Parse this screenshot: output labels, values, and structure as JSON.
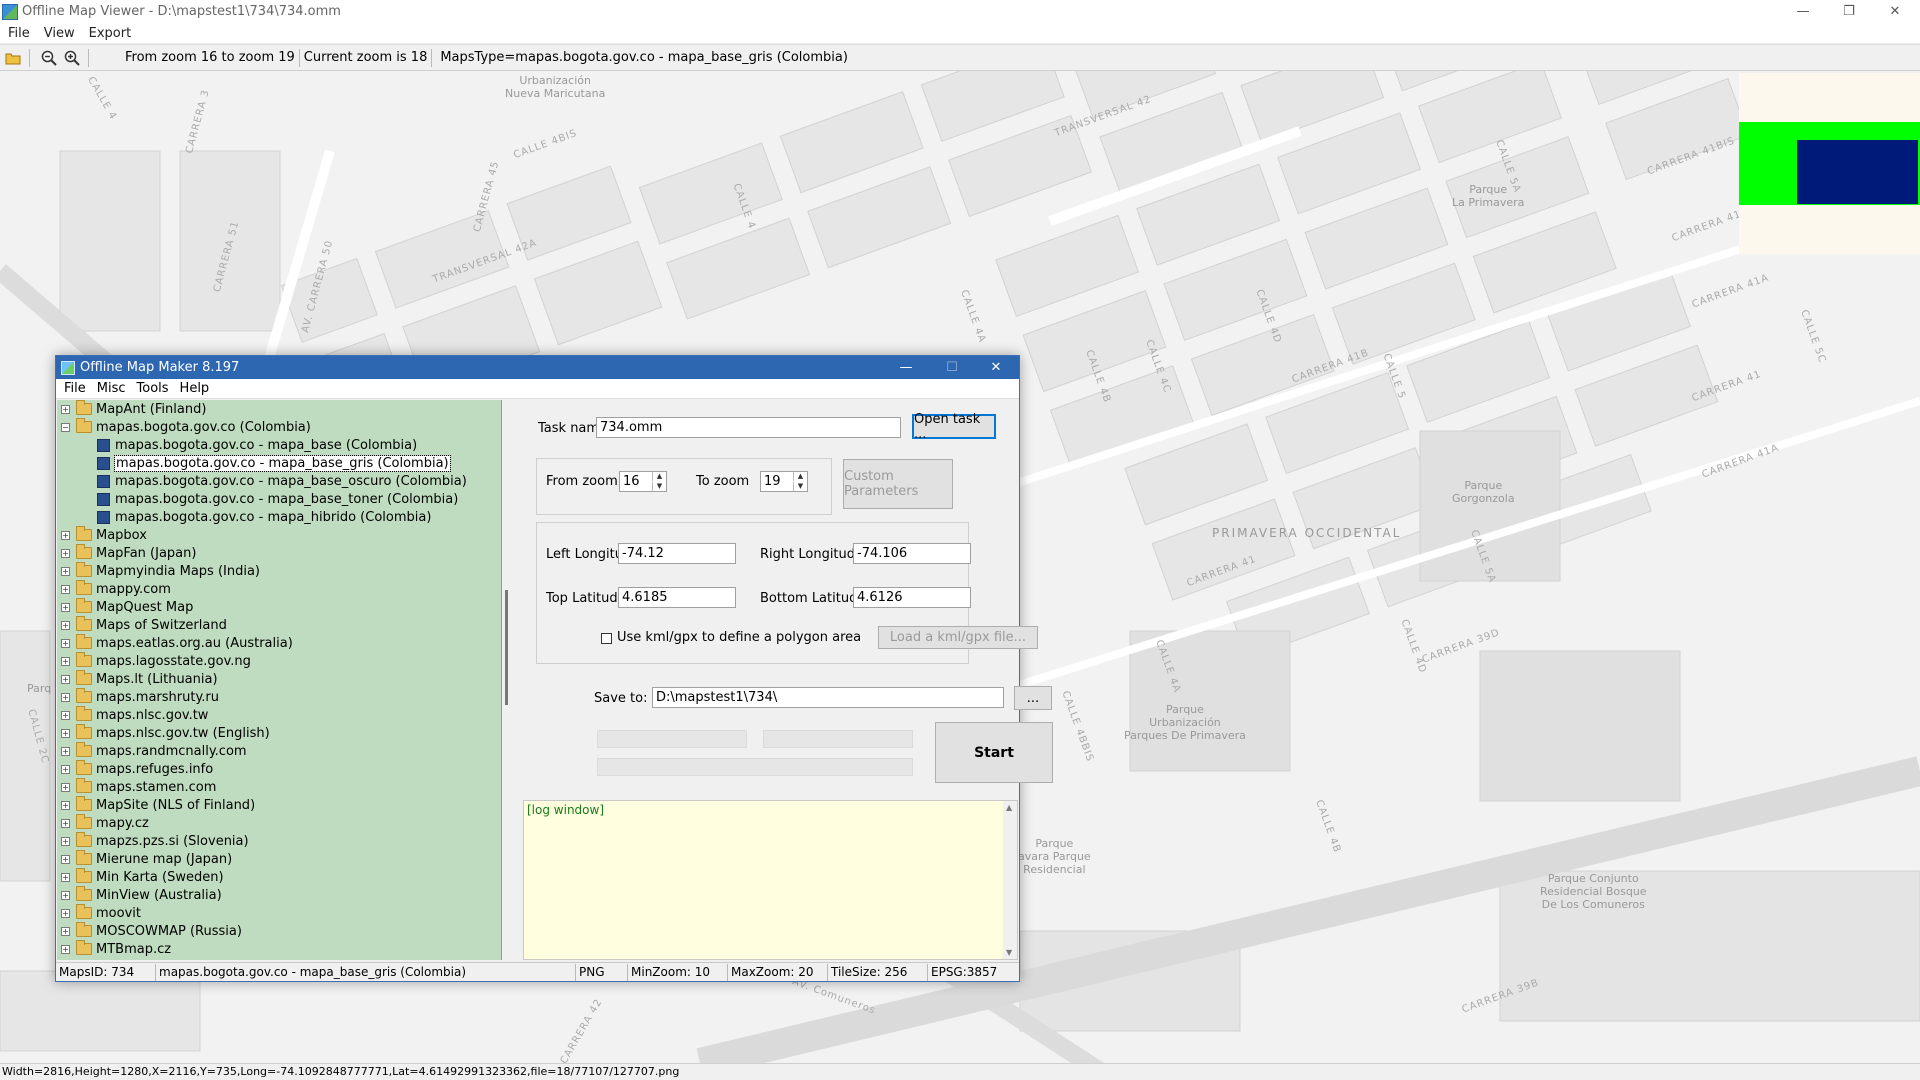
{
  "window": {
    "title": "Offline Map Viewer - D:\\mapstest1\\734\\734.omm",
    "minimize": "—",
    "restore": "❐",
    "close": "✕"
  },
  "menu": {
    "file": "File",
    "view": "View",
    "export": "Export"
  },
  "toolbar": {
    "zoom_range": "From zoom 16 to zoom 19",
    "current_zoom": "Current zoom is 18",
    "maps_type": "MapsType=mapas.bogota.gov.co - mapa_base_gris (Colombia)"
  },
  "map": {
    "labels": {
      "urb_nueva_maricutana": "Urbanización\nNueva Maricutana",
      "parque_la_primavera": "Parque\nLa Primavera",
      "parque_gorgonzola": "Parque\nGorgonzola",
      "primavera_occidental": "PRIMAVERA OCCIDENTAL",
      "parque_urb": "Parque\nUrbanización\nParques De Primavera",
      "parque_avara": "Parque\navara Parque\nResidencial",
      "parque_conjunto": "Parque Conjunto\nResidencial Bosque\nDe Los Comuneros",
      "parq_left": "Parq"
    },
    "streets": {
      "calle4": "CALLE 4",
      "carrera3": "CARRERA 3",
      "carrera5": "CARRERA 5",
      "transversal42": "TRANSVERSAL 42",
      "transversal42a": "TRANSVERSAL 42A",
      "carrera45": "CARRERA 45",
      "calle4bis": "CALLE 4BIS",
      "calle4_2": "CALLE 4",
      "av_carrera50": "AV. CARRERA 50",
      "carrera51": "CARRERA 51",
      "calle5a": "CALLE 5A",
      "calle5bis": "CALLE 5BIS",
      "carrera41bis": "CARRERA 41BIS",
      "carrera41": "CARRERA 41",
      "carrera41a": "CARRERA 41A",
      "carrera41b": "CARRERA 41B",
      "calle5c": "CALLE 5C",
      "calle4a": "CALLE 4A",
      "calle4b": "CALLE 4B",
      "calle4d": "CALLE 4D",
      "calle4c": "CALLE 4C",
      "calle3bis": "CALLE 3BIS",
      "calle5": "CALLE 5",
      "calle5a2": "CALLE 5A",
      "carrera39d": "CARRERA 39D",
      "calle4e": "CALLE 4E",
      "calle4a2": "CALLE 4A",
      "calle4bbis": "CALLE 4BBIS",
      "calle4d2": "CALLE 4D",
      "calle2c": "CALLE 2C",
      "carrera39b": "CARRERA 39B",
      "carrera41a2": "CARRERA 41A",
      "av_comuneros": "AV. Comuneros",
      "carrera42": "CARRERA 42"
    }
  },
  "dialog": {
    "title": "Offline Map Maker 8.197",
    "menu": {
      "file": "File",
      "misc": "Misc",
      "tools": "Tools",
      "help": "Help"
    },
    "tree": [
      {
        "label": "MapAnt (Finland)",
        "type": "folder",
        "expanded": false
      },
      {
        "label": "mapas.bogota.gov.co (Colombia)",
        "type": "folder",
        "expanded": true
      },
      {
        "label": "mapas.bogota.gov.co - mapa_base (Colombia)",
        "type": "map"
      },
      {
        "label": "mapas.bogota.gov.co - mapa_base_gris (Colombia)",
        "type": "map",
        "selected": true
      },
      {
        "label": "mapas.bogota.gov.co - mapa_base_oscuro (Colombia)",
        "type": "map"
      },
      {
        "label": "mapas.bogota.gov.co - mapa_base_toner (Colombia)",
        "type": "map"
      },
      {
        "label": "mapas.bogota.gov.co - mapa_hibrido (Colombia)",
        "type": "map"
      },
      {
        "label": "Mapbox",
        "type": "folder"
      },
      {
        "label": "MapFan (Japan)",
        "type": "folder"
      },
      {
        "label": "Mapmyindia Maps (India)",
        "type": "folder"
      },
      {
        "label": "mappy.com",
        "type": "folder"
      },
      {
        "label": "MapQuest Map",
        "type": "folder"
      },
      {
        "label": "Maps of Switzerland",
        "type": "folder"
      },
      {
        "label": "maps.eatlas.org.au (Australia)",
        "type": "folder"
      },
      {
        "label": "maps.lagosstate.gov.ng",
        "type": "folder"
      },
      {
        "label": "Maps.lt (Lithuania)",
        "type": "folder"
      },
      {
        "label": "maps.marshruty.ru",
        "type": "folder"
      },
      {
        "label": "maps.nlsc.gov.tw",
        "type": "folder"
      },
      {
        "label": "maps.nlsc.gov.tw (English)",
        "type": "folder"
      },
      {
        "label": "maps.randmcnally.com",
        "type": "folder"
      },
      {
        "label": "maps.refuges.info",
        "type": "folder"
      },
      {
        "label": "maps.stamen.com",
        "type": "folder"
      },
      {
        "label": "MapSite (NLS of Finland)",
        "type": "folder"
      },
      {
        "label": "mapy.cz",
        "type": "folder"
      },
      {
        "label": "mapzs.pzs.si (Slovenia)",
        "type": "folder"
      },
      {
        "label": "Mierune map (Japan)",
        "type": "folder"
      },
      {
        "label": "Min Karta (Sweden)",
        "type": "folder"
      },
      {
        "label": "MinView (Australia)",
        "type": "folder"
      },
      {
        "label": "moovit",
        "type": "folder"
      },
      {
        "label": "MOSCOWMAP (Russia)",
        "type": "folder"
      },
      {
        "label": "MTBmap.cz",
        "type": "folder"
      }
    ],
    "form": {
      "task_name_label": "Task name",
      "task_name_value": "734.omm",
      "open_task": "Open task ...",
      "from_zoom_label": "From zoom",
      "from_zoom_value": "16",
      "to_zoom_label": "To zoom",
      "to_zoom_value": "19",
      "custom_params": "Custom Parameters",
      "left_lon_label": "Left Longitude",
      "left_lon_value": "-74.12",
      "right_lon_label": "Right Longitude",
      "right_lon_value": "-74.106",
      "top_lat_label": "Top Latitude",
      "top_lat_value": "4.6185",
      "bottom_lat_label": "Bottom Latitude",
      "bottom_lat_value": "4.6126",
      "kml_label": "Use kml/gpx to define a polygon area",
      "load_kml": "Load a kml/gpx file...",
      "save_to_label": "Save to:",
      "save_to_value": "D:\\mapstest1\\734\\",
      "browse": "...",
      "start": "Start"
    },
    "log": "[log window]",
    "status": {
      "maps_id": "MapsID: 734",
      "map_name": "mapas.bogota.gov.co - mapa_base_gris (Colombia)",
      "format": "PNG",
      "min_zoom": "MinZoom: 10",
      "max_zoom": "MaxZoom: 20",
      "tile_size": "TileSize: 256",
      "epsg": "EPSG:3857"
    }
  },
  "status_bar": "Width=2816,Height=1280,X=2116,Y=735,Long=-74.1092848777771,Lat=4.61492991323362,file=18/77107/127707.png",
  "colors": {
    "accent": "#2e67b1",
    "tree_bg": "#c0dcc0",
    "log_bg": "#ffffe0",
    "overview_green": "#00ff00",
    "overview_blue": "#001a7a"
  }
}
